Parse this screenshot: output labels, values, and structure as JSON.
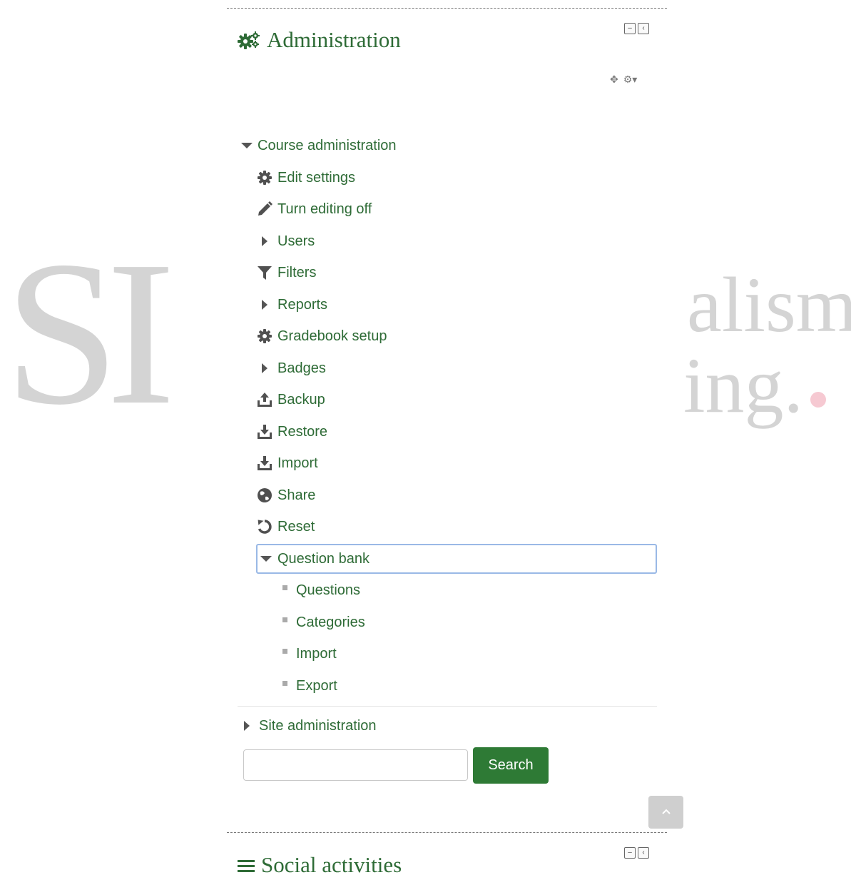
{
  "watermark": {
    "left_text": "SI",
    "right_line1": "alism",
    "right_line2": "ing."
  },
  "administration_block": {
    "title": "Administration",
    "icon": "cogs-icon",
    "controls": [
      "minus-icon",
      "dock-left-icon"
    ],
    "actions": [
      "move-icon",
      "gear-dropdown-icon"
    ]
  },
  "course_admin": {
    "label": "Course administration",
    "items": [
      {
        "label": "Edit settings",
        "icon": "gear-icon"
      },
      {
        "label": "Turn editing off",
        "icon": "pencil-icon"
      },
      {
        "label": "Users",
        "icon": "caret-right-icon"
      },
      {
        "label": "Filters",
        "icon": "filter-icon"
      },
      {
        "label": "Reports",
        "icon": "caret-right-icon"
      },
      {
        "label": "Gradebook setup",
        "icon": "gear-icon"
      },
      {
        "label": "Badges",
        "icon": "caret-right-icon"
      },
      {
        "label": "Backup",
        "icon": "upload-icon"
      },
      {
        "label": "Restore",
        "icon": "download-icon"
      },
      {
        "label": "Import",
        "icon": "download-icon"
      },
      {
        "label": "Share",
        "icon": "globe-icon"
      },
      {
        "label": "Reset",
        "icon": "reset-icon"
      }
    ],
    "question_bank": {
      "label": "Question bank",
      "items": [
        "Questions",
        "Categories",
        "Import",
        "Export"
      ]
    }
  },
  "site_admin": {
    "label": "Site administration"
  },
  "search": {
    "value": "",
    "button_label": "Search"
  },
  "social_block": {
    "title": "Social activities",
    "icon": "bars-icon"
  },
  "colors": {
    "link_green": "#2e6b36",
    "button_green": "#2e7a35",
    "focus_border": "#9ab9e6"
  }
}
